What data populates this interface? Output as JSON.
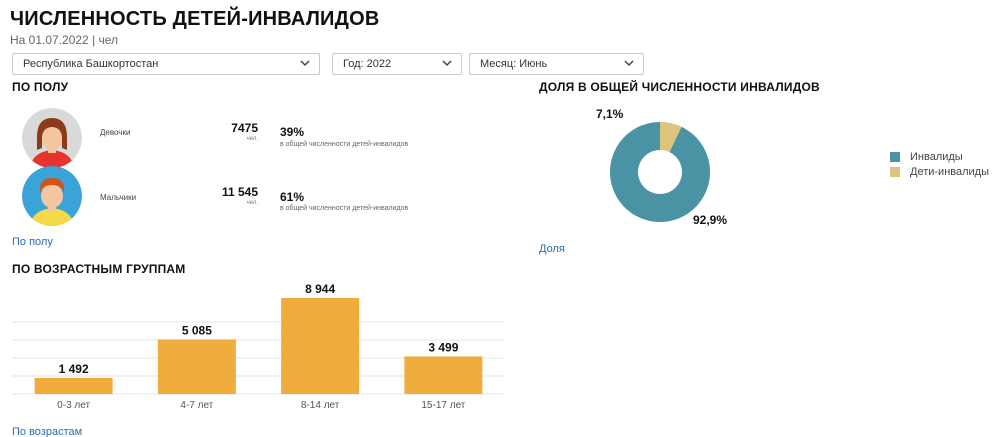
{
  "header": {
    "title": "ЧИСЛЕННОСТЬ ДЕТЕЙ-ИНВАЛИДОВ",
    "subtitle": "На 01.07.2022 | чел"
  },
  "filters": {
    "region": "Республика Башкортостан",
    "year": "Год: 2022",
    "month": "Месяц: Июнь"
  },
  "gender": {
    "heading": "ПО ПОЛУ",
    "girls": {
      "label": "Девочки",
      "value": "7475",
      "unit": "чел.",
      "percent": "39%",
      "percent_note": "в общей численности детей-инвалидов"
    },
    "boys": {
      "label": "Мальчики",
      "value": "11 545",
      "unit": "чел.",
      "percent": "61%",
      "percent_note": "в общей численности детей-инвалидов"
    },
    "link": "По полу"
  },
  "share": {
    "heading": "ДОЛЯ В ОБЩЕЙ ЧИСЛЕННОСТИ ИНВАЛИДОВ",
    "link": "Доля"
  },
  "age": {
    "heading": "ПО ВОЗРАСТНЫМ ГРУППАМ",
    "link": "По возрастам"
  },
  "colors": {
    "bar": "#f0ad3e",
    "donut_main": "#4a93a4",
    "donut_small": "#dcc47c",
    "girl_shirt": "#e8322e",
    "boy_shirt": "#f5d94a"
  },
  "chart_data": [
    {
      "type": "pie",
      "title": "ДОЛЯ В ОБЩЕЙ ЧИСЛЕННОСТИ ИНВАЛИДОВ",
      "categories": [
        "Инвалиды",
        "Дети-инвалиды"
      ],
      "values": [
        92.9,
        7.1
      ],
      "data_labels": [
        "92,9%",
        "7,1%"
      ],
      "colors": [
        "#4a93a4",
        "#dcc47c"
      ],
      "donut": true,
      "legend": "right"
    },
    {
      "type": "bar",
      "title": "ПО ВОЗРАСТНЫМ ГРУППАМ",
      "categories": [
        "0-3 лет",
        "4-7 лет",
        "8-14 лет",
        "15-17 лет"
      ],
      "values": [
        1492,
        5085,
        8944,
        3499
      ],
      "data_labels": [
        "1 492",
        "5 085",
        "8 944",
        "3 499"
      ],
      "color": "#f0ad3e",
      "ylim": [
        0,
        8944
      ],
      "grid": true
    }
  ]
}
